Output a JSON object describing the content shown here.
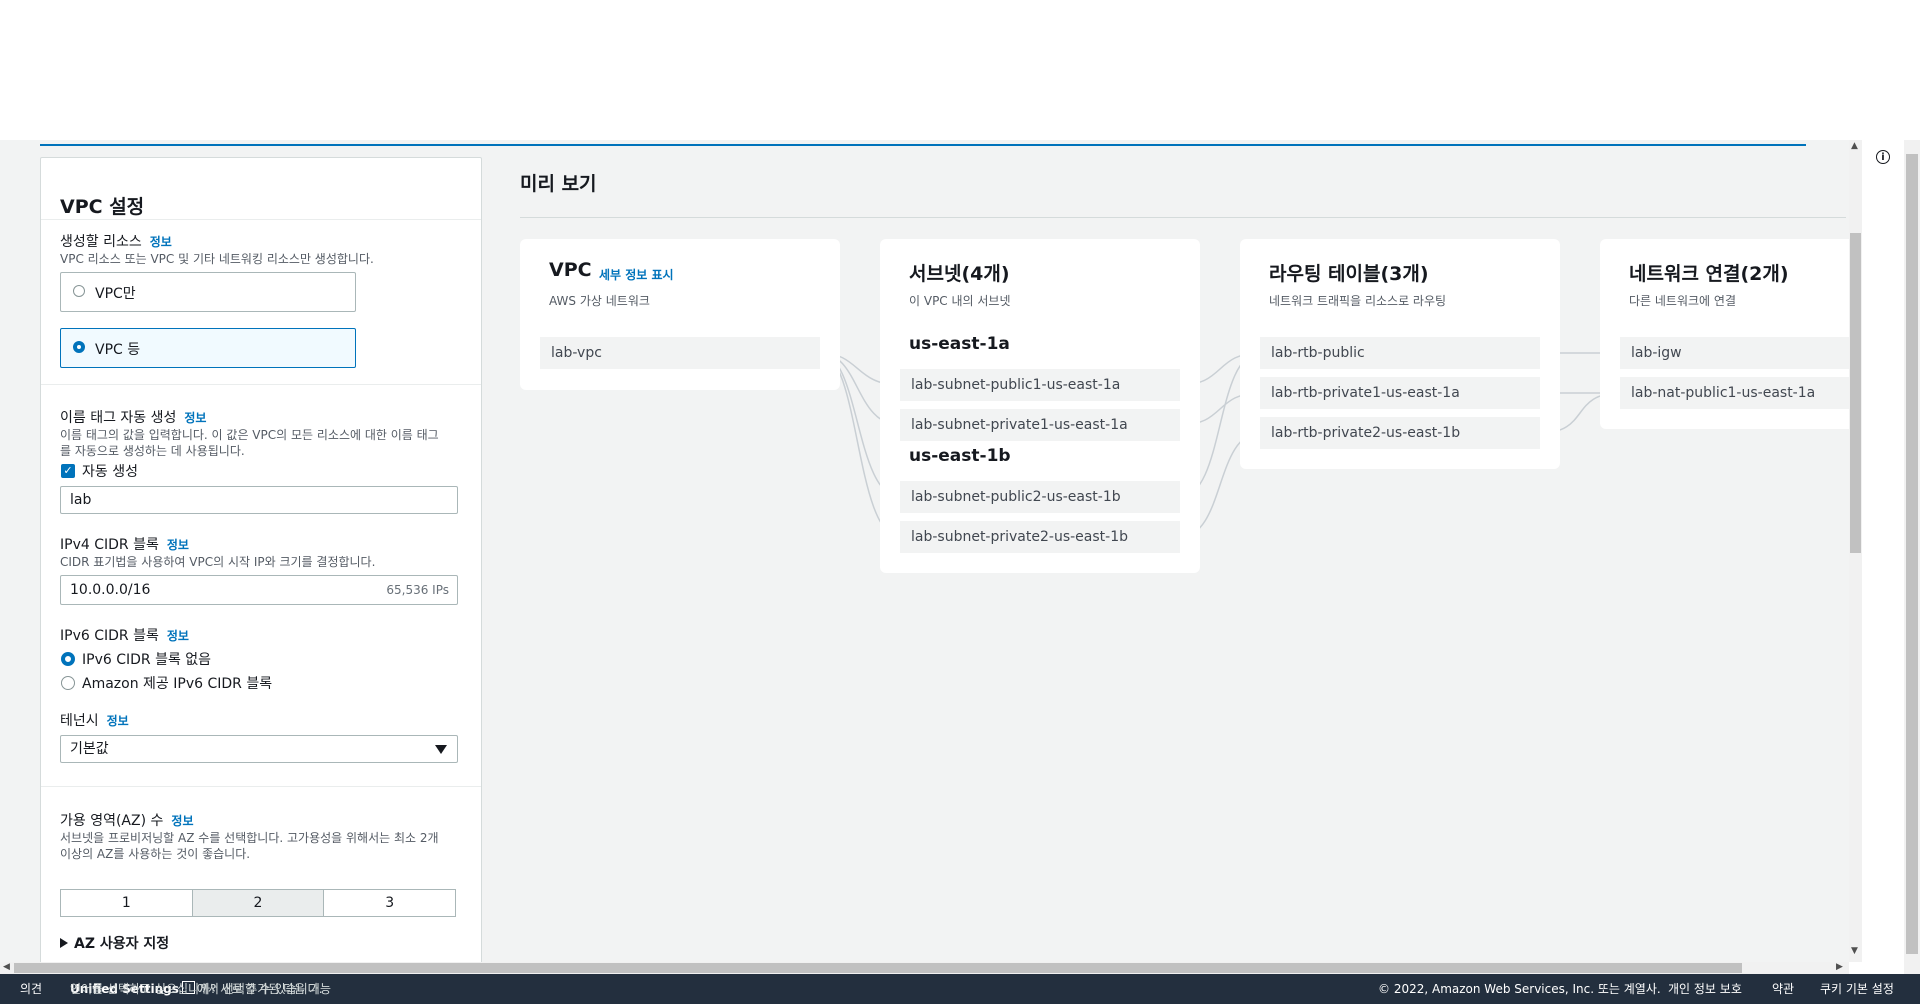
{
  "left_panel": {
    "title": "VPC 설정",
    "resources": {
      "label": "생성할 리소스",
      "info": "정보",
      "desc": "VPC 리소스 또는 VPC 및 기타 네트워킹 리소스만 생성합니다.",
      "option_vpc_only": "VPC만",
      "option_vpc_more": "VPC 등",
      "selected": "VPC 등"
    },
    "name_tag": {
      "label": "이름 태그 자동 생성",
      "info": "정보",
      "desc1": "이름 태그의 값을 입력합니다. 이 값은 VPC의 모든 리소스에 대한 이름 태그",
      "desc2": "를 자동으로 생성하는 데 사용됩니다.",
      "checkbox_label": "자동 생성",
      "checked": true,
      "value": "lab"
    },
    "ipv4": {
      "label": "IPv4 CIDR 블록",
      "info": "정보",
      "desc": "CIDR 표기법을 사용하여 VPC의 시작 IP와 크기를 결정합니다.",
      "value": "10.0.0.0/16",
      "suffix": "65,536 IPs"
    },
    "ipv6": {
      "label": "IPv6 CIDR 블록",
      "info": "정보",
      "option_none": "IPv6 CIDR 블록 없음",
      "option_amazon": "Amazon 제공 IPv6 CIDR 블록",
      "selected": "IPv6 CIDR 블록 없음"
    },
    "tenancy": {
      "label": "테넌시",
      "info": "정보",
      "value": "기본값"
    },
    "az": {
      "label": "가용 영역(AZ) 수",
      "info": "정보",
      "desc1": "서브넷을 프로비저닝할 AZ 수를 선택합니다. 고가용성을 위해서는 최소 2개",
      "desc2": "이상의 AZ를 사용하는 것이 좋습니다.",
      "options": [
        "1",
        "2",
        "3"
      ],
      "selected": "2",
      "customize": "AZ 사용자 지정"
    }
  },
  "preview": {
    "title": "미리 보기",
    "vpc_card": {
      "title": "VPC",
      "detail_link": "세부 정보 표시",
      "subtitle": "AWS 가상 네트워크",
      "items": [
        "lab-vpc"
      ]
    },
    "subnet_card": {
      "title": "서브넷(4개)",
      "subtitle": "이 VPC 내의 서브넷",
      "az1": "us-east-1a",
      "az1_items": [
        "lab-subnet-public1-us-east-1a",
        "lab-subnet-private1-us-east-1a"
      ],
      "az2": "us-east-1b",
      "az2_items": [
        "lab-subnet-public2-us-east-1b",
        "lab-subnet-private2-us-east-1b"
      ]
    },
    "route_card": {
      "title": "라우팅 테이블(3개)",
      "subtitle": "네트워크 트래픽을 리소스로 라우팅",
      "items": [
        "lab-rtb-public",
        "lab-rtb-private1-us-east-1a",
        "lab-rtb-private2-us-east-1b"
      ]
    },
    "network_card": {
      "title": "네트워크 연결(2개)",
      "subtitle": "다른 네트워크에 연결",
      "items": [
        "lab-igw",
        "lab-nat-public1-us-east-1a"
      ]
    }
  },
  "footer": {
    "feedback": "의견",
    "lang_msg_prefix": "언어를 선택하고 싶으십니까? 새로 추가된 다음 기능",
    "unified_settings": "Unified Settings",
    "lang_msg_suffix": "에서 선택할 수 있습니다.",
    "copyright": "© 2022, Amazon Web Services, Inc. 또는 계열사.",
    "privacy": "개인 정보 보호",
    "terms": "약관",
    "cookies": "쿠키 기본 설정"
  },
  "colors": {
    "accent": "#0073bb",
    "footer_bg": "#232f3e",
    "panel_bg": "#f2f3f3",
    "connector": "#c9cfd4"
  },
  "icons": [
    "info-icon",
    "external-link-icon",
    "caret-down-icon",
    "expand-arrow-icon"
  ]
}
